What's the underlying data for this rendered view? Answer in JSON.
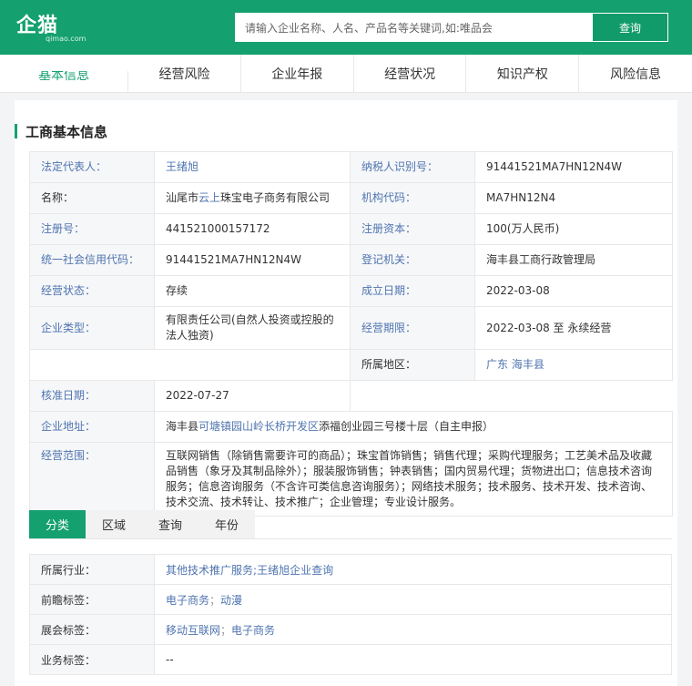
{
  "header": {
    "logo_text": "企猫",
    "logo_sub": "qimao.com",
    "search_placeholder": "请输入企业名称、人名、产品名等关键词,如:唯品会",
    "search_button": "查询"
  },
  "nav": {
    "tabs": [
      "基本信息",
      "经营风险",
      "企业年报",
      "经营状况",
      "知识产权",
      "风险信息"
    ]
  },
  "section": {
    "title": "工商基本信息"
  },
  "info": {
    "legal_rep_label": "法定代表人：",
    "legal_rep_value": "王绪旭",
    "tax_id_label": "纳税人识别号：",
    "tax_id_value": "91441521MA7HN12N4W",
    "name_label": "名称：",
    "name_prefix": "汕尾市",
    "name_link": "云上",
    "name_suffix": "珠宝电子商务有限公司",
    "org_code_label": "机构代码：",
    "org_code_value": "MA7HN12N4",
    "reg_no_label": "注册号：",
    "reg_no_value": "441521000157172",
    "reg_capital_label": "注册资本：",
    "reg_capital_value": "100(万人民币)",
    "credit_code_label": "统一社会信用代码：",
    "credit_code_value": "91441521MA7HN12N4W",
    "reg_authority_label": "登记机关：",
    "reg_authority_value": "海丰县工商行政管理局",
    "status_label": "经营状态：",
    "status_value": "存续",
    "founded_label": "成立日期：",
    "founded_value": "2022-03-08",
    "type_label": "企业类型：",
    "type_value": "有限责任公司(自然人投资或控股的法人独资)",
    "term_label": "经营期限：",
    "term_value": "2022-03-08 至 永续经营",
    "region_label": "所属地区：",
    "region_value": "广东 海丰县",
    "approved_label": "核准日期：",
    "approved_value": "2022-07-27",
    "address_label": "企业地址：",
    "address_prefix": "海丰县",
    "address_link": "可塘镇园山岭长桥开发区",
    "address_suffix": "添福创业园三号楼十层（自主申报）",
    "scope_label": "经营范围：",
    "scope_value": "互联网销售（除销售需要许可的商品）；珠宝首饰销售；销售代理；采购代理服务；工艺美术品及收藏品销售（象牙及其制品除外）；服装服饰销售；钟表销售；国内贸易代理；货物进出口；信息技术咨询服务；信息咨询服务（不含许可类信息咨询服务）；网络技术服务；技术服务、技术开发、技术咨询、技术交流、技术转让、技术推广；企业管理；专业设计服务。"
  },
  "subtabs": [
    "分类",
    "区域",
    "查询",
    "年份"
  ],
  "tags": {
    "industry_label": "所属行业：",
    "industry_a": "其他技术推广服务",
    "industry_sep": ";",
    "industry_b": "王绪旭企业查询",
    "forward_label": "前瞻标签：",
    "forward_a": "电子商务",
    "forward_sep": "；",
    "forward_b": "动漫",
    "expo_label": "展会标签：",
    "expo_a": "移动互联网",
    "expo_sep": "；",
    "expo_b": "电子商务",
    "biz_label": "业务标签：",
    "biz_value": "--"
  },
  "colors": {
    "brand": "#14a06f",
    "link": "#4f74b0"
  }
}
